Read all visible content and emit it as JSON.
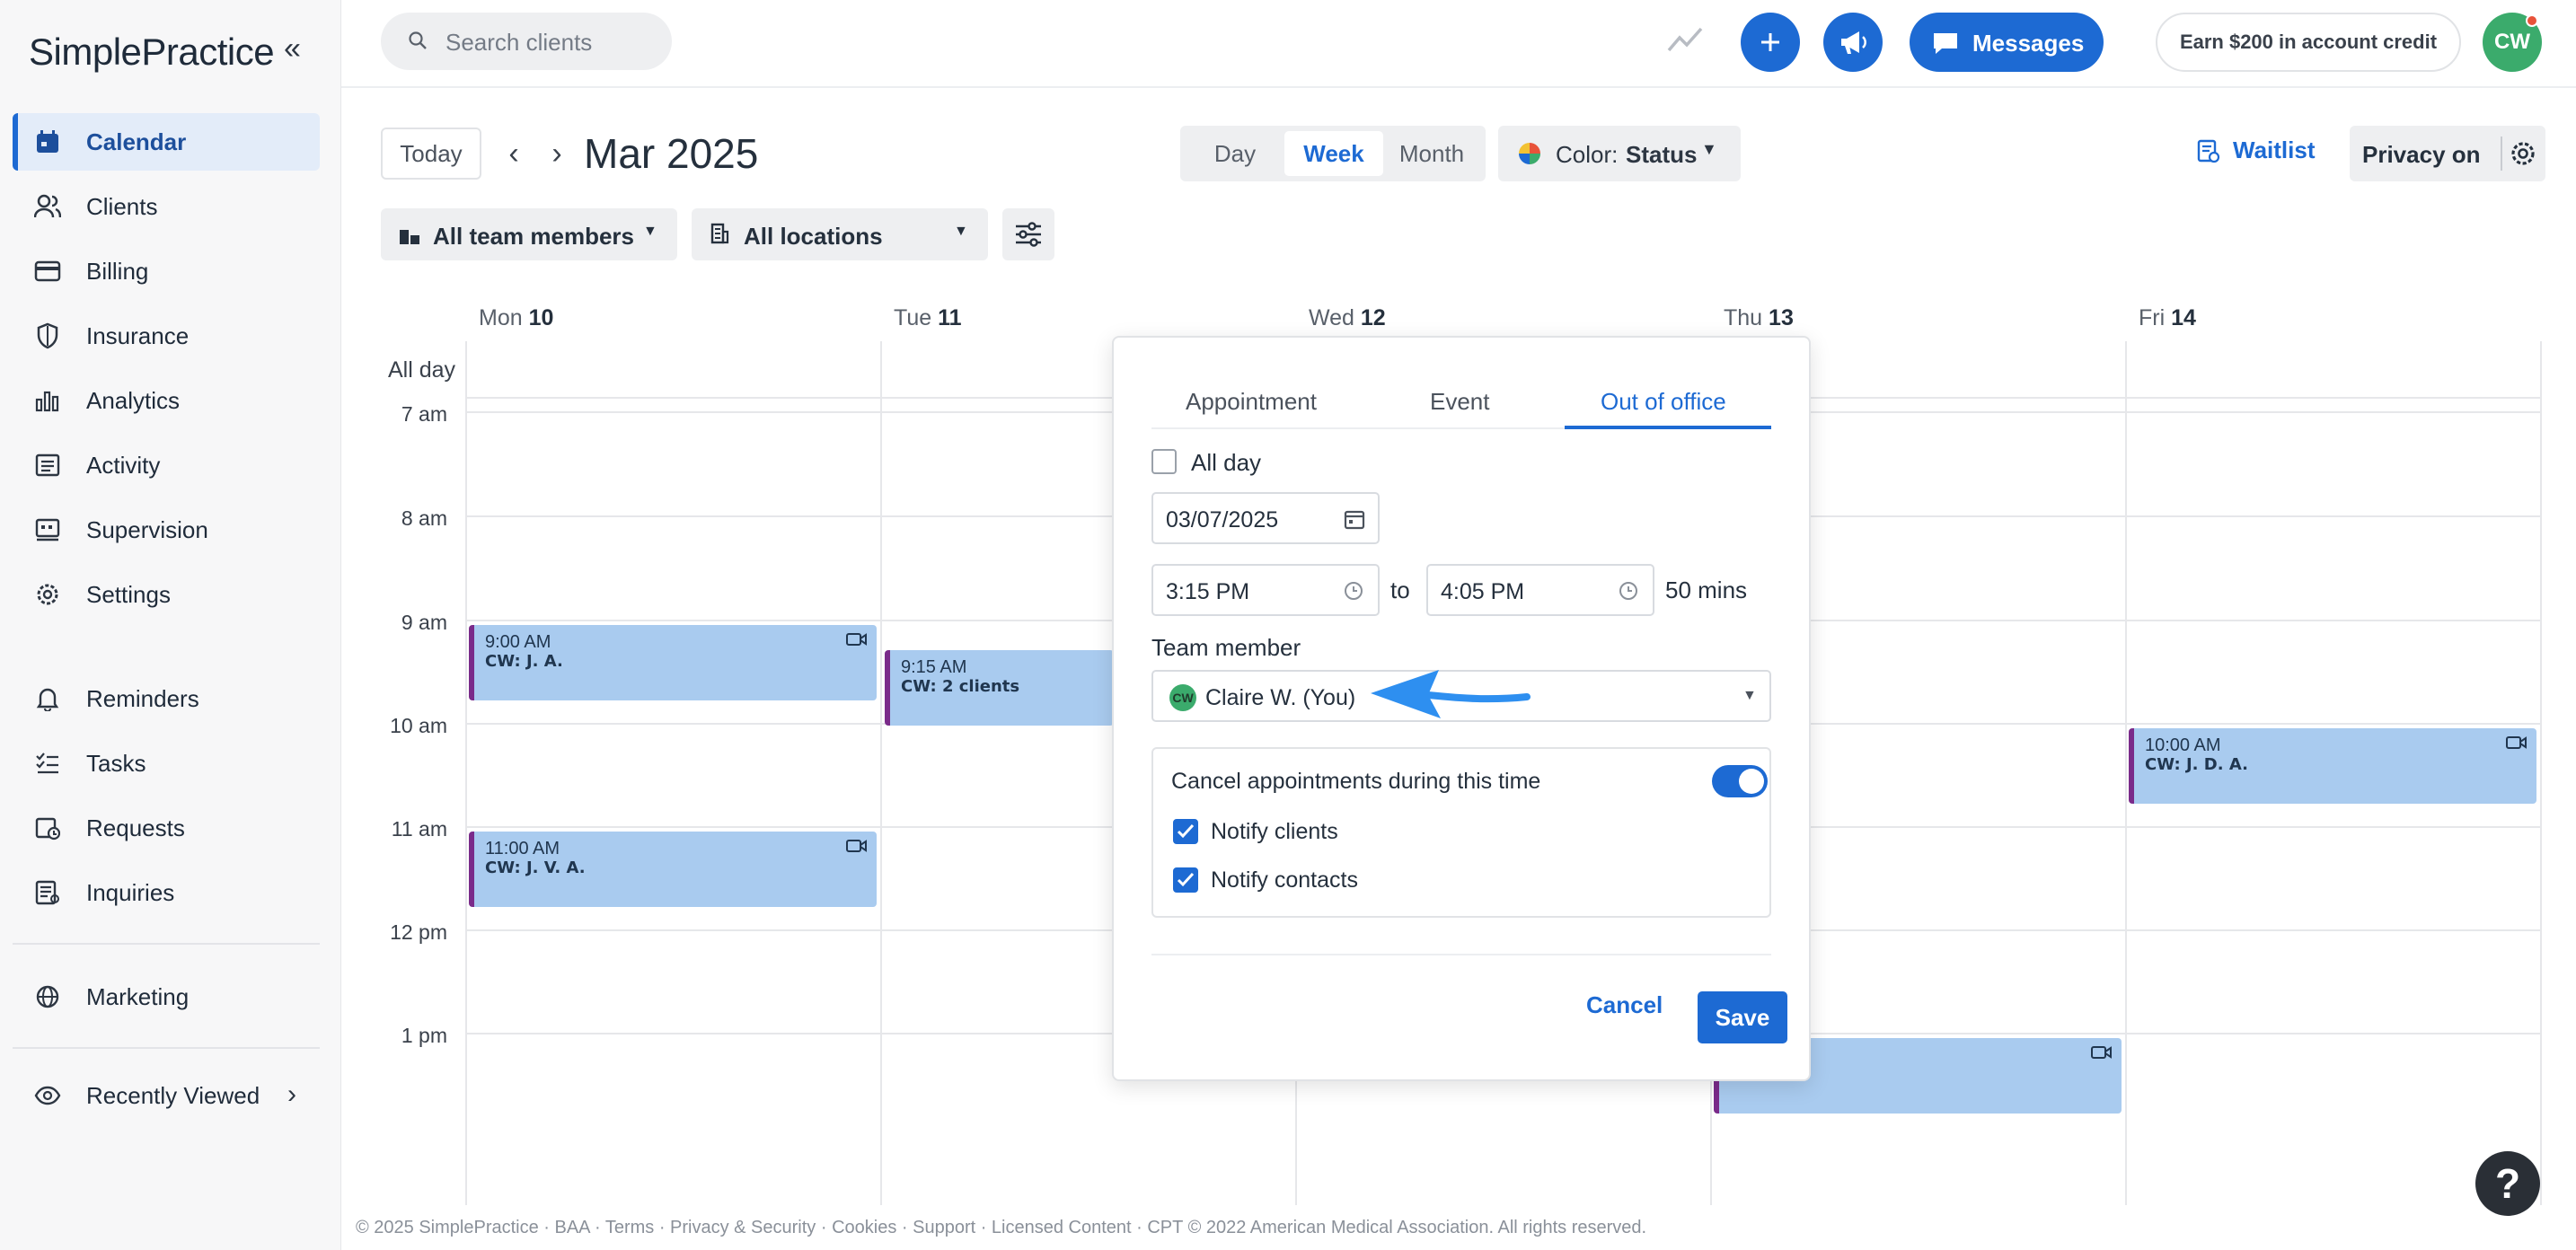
{
  "sidebar": {
    "logo": "SimplePractice",
    "items": [
      {
        "label": "Calendar",
        "icon": "calendar-icon",
        "active": true
      },
      {
        "label": "Clients",
        "icon": "clients-icon"
      },
      {
        "label": "Billing",
        "icon": "billing-icon"
      },
      {
        "label": "Insurance",
        "icon": "insurance-icon"
      },
      {
        "label": "Analytics",
        "icon": "analytics-icon"
      },
      {
        "label": "Activity",
        "icon": "activity-icon"
      },
      {
        "label": "Supervision",
        "icon": "supervision-icon"
      },
      {
        "label": "Settings",
        "icon": "settings-icon"
      },
      {
        "label": "Reminders",
        "icon": "bell-icon"
      },
      {
        "label": "Tasks",
        "icon": "tasks-icon"
      },
      {
        "label": "Requests",
        "icon": "requests-icon"
      },
      {
        "label": "Inquiries",
        "icon": "inquiries-icon"
      },
      {
        "label": "Marketing",
        "icon": "globe-icon"
      },
      {
        "label": "Recently Viewed",
        "icon": "eye-icon"
      }
    ]
  },
  "topbar": {
    "search_placeholder": "Search clients",
    "messages_label": "Messages",
    "earn_label": "Earn $200 in account credit",
    "avatar_initials": "CW"
  },
  "toolbar": {
    "today": "Today",
    "month_title": "Mar 2025",
    "views": [
      "Day",
      "Week",
      "Month"
    ],
    "active_view": "Week",
    "color_prefix": "Color:",
    "color_value": "Status",
    "waitlist": "Waitlist",
    "privacy": "Privacy on",
    "team_filter": "All team members",
    "location_filter": "All locations"
  },
  "calendar": {
    "days": [
      {
        "name": "Mon",
        "num": "10"
      },
      {
        "name": "Tue",
        "num": "11"
      },
      {
        "name": "Wed",
        "num": "12"
      },
      {
        "name": "Thu",
        "num": "13"
      },
      {
        "name": "Fri",
        "num": "14"
      }
    ],
    "all_day": "All day",
    "times": [
      "7 am",
      "8 am",
      "9 am",
      "10 am",
      "11 am",
      "12 pm",
      "1 pm"
    ],
    "appointments": [
      {
        "time": "9:00 AM",
        "name": "CW: J. A."
      },
      {
        "time": "9:15 AM",
        "name": "CW: 2 clients"
      },
      {
        "time": "11:00 AM",
        "name": "CW: J. V. A."
      },
      {
        "time": "10:00 AM",
        "name": "CW: J. D. A."
      }
    ]
  },
  "modal": {
    "tabs": [
      "Appointment",
      "Event",
      "Out of office"
    ],
    "active_tab": "Out of office",
    "all_day_label": "All day",
    "all_day_checked": false,
    "date": "03/07/2025",
    "start_time": "3:15 PM",
    "to_label": "to",
    "end_time": "4:05 PM",
    "duration": "50 mins",
    "team_member_label": "Team member",
    "team_member_initials": "CW",
    "team_member_value": "Claire W. (You)",
    "cancel_appts_label": "Cancel appointments during this time",
    "cancel_appts_on": true,
    "notify_clients": "Notify clients",
    "notify_contacts": "Notify contacts",
    "cancel_button": "Cancel",
    "save_button": "Save"
  },
  "footer": {
    "text": "© 2025 SimplePractice · BAA · Terms · Privacy & Security · Cookies · Support · Licensed Content · CPT © 2022 American Medical Association. All rights reserved."
  },
  "help_label": "?",
  "colors": {
    "accent": "#1d6ad3",
    "appointment": "#a9cbef",
    "appointment_border": "#7a2b8a",
    "avatar": "#3bab6c"
  }
}
